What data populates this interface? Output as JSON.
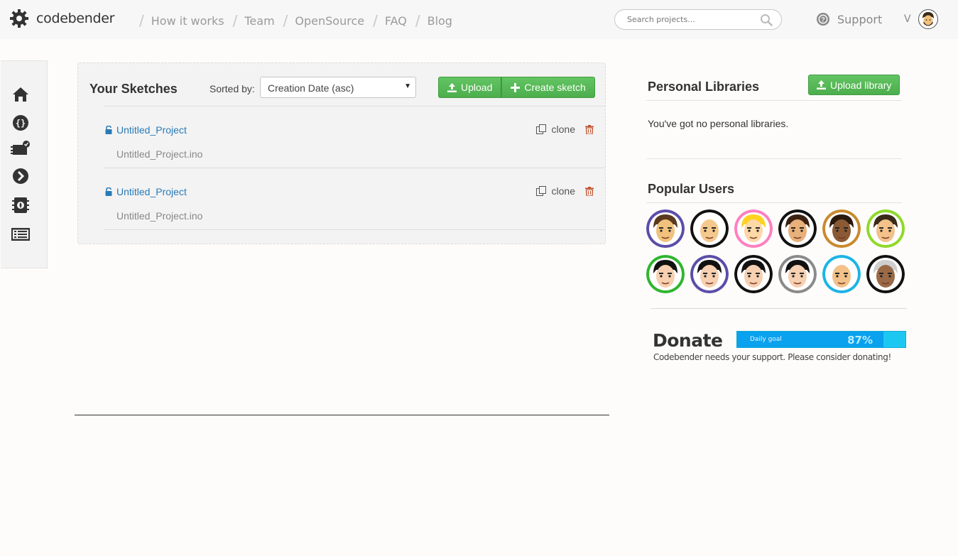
{
  "brand": {
    "name": "codebender"
  },
  "nav": {
    "items": [
      {
        "label": "How it works"
      },
      {
        "label": "Team"
      },
      {
        "label": "OpenSource"
      },
      {
        "label": "FAQ"
      },
      {
        "label": "Blog"
      }
    ]
  },
  "search": {
    "placeholder": "Search projects..."
  },
  "support": {
    "label": "Support"
  },
  "user_menu": {
    "chevron": "V"
  },
  "sidebar": {
    "icons": [
      "home-icon",
      "braces-icon",
      "board-icon",
      "arrow-right-circle-icon",
      "chip-icon",
      "list-icon"
    ]
  },
  "sketches": {
    "title": "Your Sketches",
    "sort_label": "Sorted by:",
    "sort_value": "Creation Date (asc)",
    "upload_label": "Upload",
    "create_label": "Create sketch",
    "items": [
      {
        "name": "Untitled_Project",
        "file": "Untitled_Project.ino",
        "clone_label": "clone"
      },
      {
        "name": "Untitled_Project",
        "file": "Untitled_Project.ino",
        "clone_label": "clone"
      }
    ]
  },
  "libraries": {
    "title": "Personal Libraries",
    "upload_label": "Upload library",
    "empty_text": "You've got no personal libraries."
  },
  "popular_users": {
    "title": "Popular Users",
    "avatars": [
      {
        "ring": "#5b4ea8",
        "skin": "#f1c27d",
        "hair": "#5a3a1e"
      },
      {
        "ring": "#111111",
        "skin": "#f5c98e",
        "hair": "none"
      },
      {
        "ring": "#ff7fbf",
        "skin": "#ffd8a8",
        "hair": "#ffd21f"
      },
      {
        "ring": "#111111",
        "skin": "#e8b07a",
        "hair": "#3a2212"
      },
      {
        "ring": "#c98a2e",
        "skin": "#8a5a34",
        "hair": "#2a1a0e"
      },
      {
        "ring": "#8fd92a",
        "skin": "#f2c28a",
        "hair": "#3a2a1a"
      },
      {
        "ring": "#2fb52f",
        "skin": "#f6d0b0",
        "hair": "#111111"
      },
      {
        "ring": "#5b4ea8",
        "skin": "#f6d0b0",
        "hair": "#111111"
      },
      {
        "ring": "#111111",
        "skin": "#f6d0b0",
        "hair": "#111111"
      },
      {
        "ring": "#8a8a8a",
        "skin": "#f6d0b0",
        "hair": "#111111"
      },
      {
        "ring": "#1cb4e6",
        "skin": "#f2c28a",
        "hair": "none"
      },
      {
        "ring": "#111111",
        "skin": "#9a6a46",
        "hair": "#cfcfcf"
      }
    ]
  },
  "donate": {
    "title": "Donate",
    "goal_label": "Daily goal",
    "goal_percent_text": "87%",
    "goal_fraction": 0.87,
    "message": "Codebender needs your support. Please consider donating!"
  },
  "colors": {
    "accent_green": "#5cb85c",
    "link_blue": "#2a7ab6",
    "donate_blue": "#1cc8f2"
  }
}
